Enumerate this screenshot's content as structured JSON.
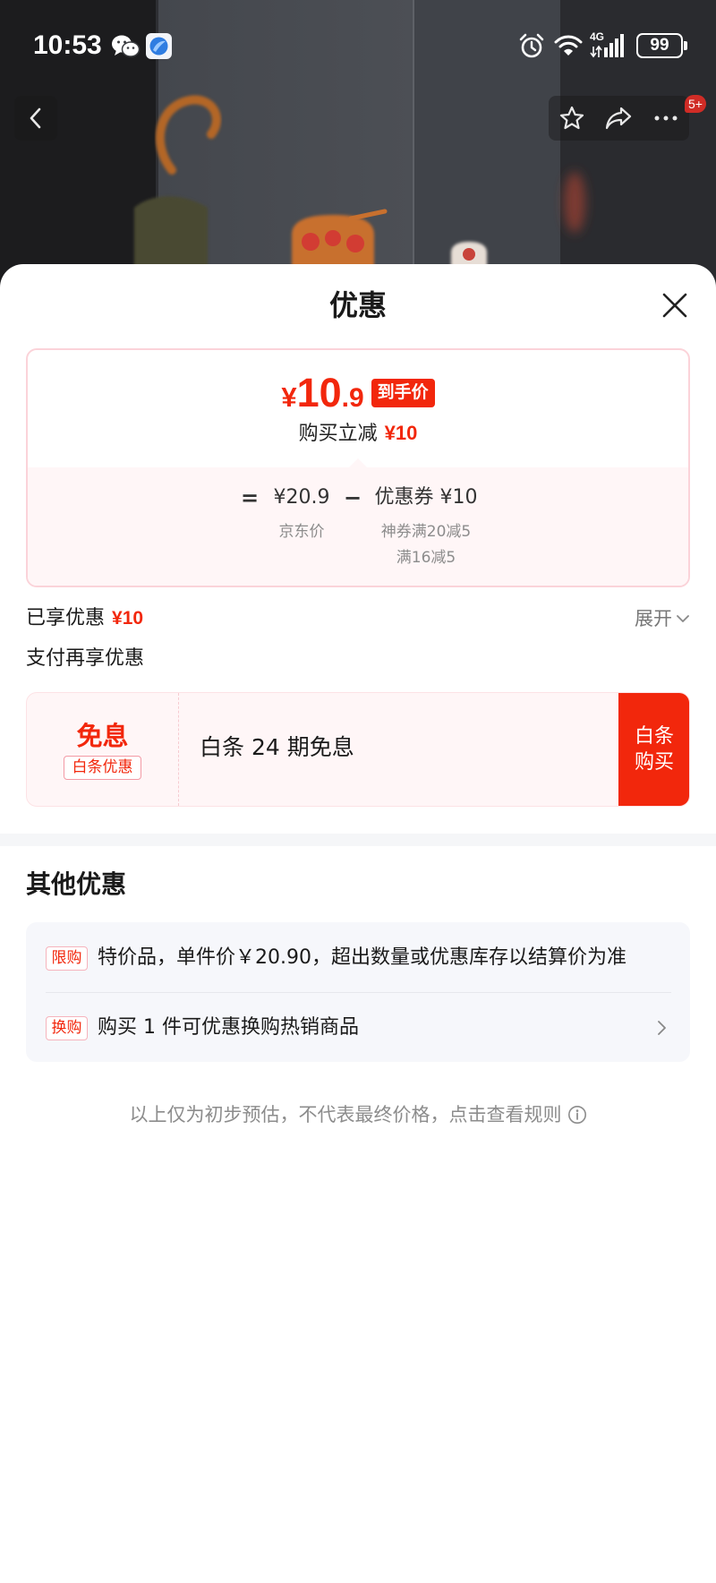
{
  "colors": {
    "accent": "#f2270c",
    "card_border": "#fbd3d9",
    "card_tint": "#fff6f7",
    "panel_gray": "#f6f7fb",
    "text": "#1a1a1a",
    "muted": "#8c8c8c"
  },
  "icons": {
    "status": [
      "wechat-icon",
      "browser-app-icon",
      "alarm-icon",
      "wifi-icon",
      "signal-icon",
      "battery-icon"
    ],
    "top_actions": [
      "back-icon",
      "star-icon",
      "share-icon",
      "more-icon"
    ],
    "sheet": [
      "close-icon",
      "chevron-down-icon",
      "chevron-right-icon",
      "info-icon"
    ]
  },
  "status_bar": {
    "time": "10:53",
    "network": "4G",
    "battery": "99"
  },
  "top_actions": {
    "badge": "5+"
  },
  "sheet": {
    "title": "优惠"
  },
  "price_card": {
    "currency": "¥",
    "price_integer": "10",
    "price_decimal": ".9",
    "price_tag": "到手价",
    "instant_discount_label": "购买立减",
    "instant_discount_value": "¥10",
    "formula": {
      "equals": "=",
      "base_price": "¥20.9",
      "base_price_label": "京东价",
      "minus": "−",
      "coupon": "优惠券 ¥10",
      "coupon_rules": [
        "神券满20减5",
        "满16减5"
      ]
    }
  },
  "enjoyed": {
    "label": "已享优惠",
    "value": "¥10",
    "expand_label": "展开"
  },
  "payment_offers": {
    "title": "支付再享优惠",
    "baitiao": {
      "headline": "免息",
      "badge": "白条优惠",
      "description": "白条 24 期免息",
      "button_line1": "白条",
      "button_line2": "购买"
    }
  },
  "other_offers": {
    "title": "其他优惠",
    "items": [
      {
        "tag": "限购",
        "text": "特价品，单件价￥20.90，超出数量或优惠库存以结算价为准"
      },
      {
        "tag": "换购",
        "text": "购买 1 件可优惠换购热销商品"
      }
    ]
  },
  "footer_note": "以上仅为初步预估，不代表最终价格，点击查看规则"
}
